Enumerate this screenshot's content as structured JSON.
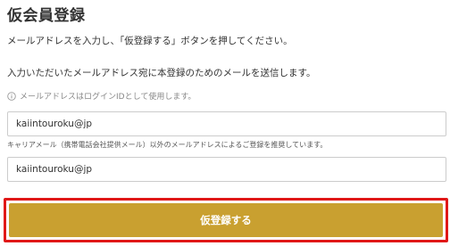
{
  "page": {
    "title": "仮会員登録",
    "instruction_1": "メールアドレスを入力し、「仮登録する」ボタンを押してください。",
    "instruction_2": "入力いただいたメールアドレス宛に本登録のためのメールを送信します。",
    "note": "メールアドレスはログインIDとして使用します。",
    "note_icon": "info-icon"
  },
  "form": {
    "email_value": "kaiintouroku@jp",
    "hint": "キャリアメール（携帯電話会社提供メール）以外のメールアドレスによるご登録を推奨しています。",
    "email_confirm_value": "kaiintouroku@jp",
    "submit_label": "仮登録する"
  },
  "colors": {
    "button_bg": "#c9a030",
    "highlight_border": "#e01818"
  }
}
